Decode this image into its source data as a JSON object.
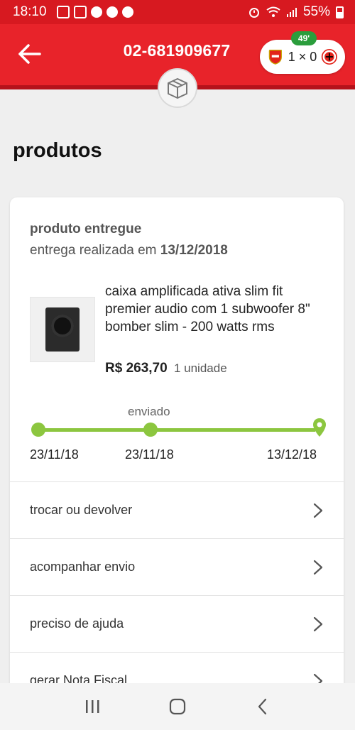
{
  "status_bar": {
    "time": "18:10",
    "battery": "55%"
  },
  "header": {
    "order_number": "02-681909677",
    "live_score": {
      "minute": "49'",
      "score": "1 × 0"
    }
  },
  "page": {
    "section_title": "produtos"
  },
  "product_card": {
    "status_title": "produto entregue",
    "status_prefix": "entrega realizada em ",
    "status_date": "13/12/2018",
    "product_name": "caixa amplificada ativa slim fit premier audio com 1 subwoofer 8\" bomber slim - 200 watts rms",
    "price": "R$ 263,70",
    "quantity": "1 unidade",
    "tracking": {
      "label": "enviado",
      "dates": [
        "23/11/18",
        "23/11/18",
        "13/12/18"
      ]
    },
    "actions": [
      {
        "label": "trocar ou devolver"
      },
      {
        "label": "acompanhar envio"
      },
      {
        "label": "preciso de ajuda"
      },
      {
        "label": "gerar Nota Fiscal"
      }
    ]
  },
  "colors": {
    "brand_red": "#e8232a",
    "status_green": "#8cc63f",
    "minute_green": "#2a9d3c"
  }
}
